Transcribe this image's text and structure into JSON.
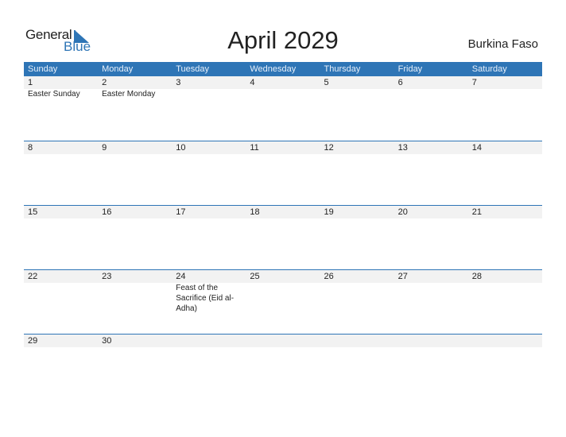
{
  "logo": {
    "general": "General",
    "blue": "Blue",
    "brand_color": "#2e75b6"
  },
  "title": "April 2029",
  "country": "Burkina Faso",
  "weekdays": [
    "Sunday",
    "Monday",
    "Tuesday",
    "Wednesday",
    "Thursday",
    "Friday",
    "Saturday"
  ],
  "weeks": [
    [
      {
        "day": "1",
        "event": "Easter Sunday"
      },
      {
        "day": "2",
        "event": "Easter Monday"
      },
      {
        "day": "3",
        "event": ""
      },
      {
        "day": "4",
        "event": ""
      },
      {
        "day": "5",
        "event": ""
      },
      {
        "day": "6",
        "event": ""
      },
      {
        "day": "7",
        "event": ""
      }
    ],
    [
      {
        "day": "8",
        "event": ""
      },
      {
        "day": "9",
        "event": ""
      },
      {
        "day": "10",
        "event": ""
      },
      {
        "day": "11",
        "event": ""
      },
      {
        "day": "12",
        "event": ""
      },
      {
        "day": "13",
        "event": ""
      },
      {
        "day": "14",
        "event": ""
      }
    ],
    [
      {
        "day": "15",
        "event": ""
      },
      {
        "day": "16",
        "event": ""
      },
      {
        "day": "17",
        "event": ""
      },
      {
        "day": "18",
        "event": ""
      },
      {
        "day": "19",
        "event": ""
      },
      {
        "day": "20",
        "event": ""
      },
      {
        "day": "21",
        "event": ""
      }
    ],
    [
      {
        "day": "22",
        "event": ""
      },
      {
        "day": "23",
        "event": ""
      },
      {
        "day": "24",
        "event": "Feast of the Sacrifice (Eid al-Adha)"
      },
      {
        "day": "25",
        "event": ""
      },
      {
        "day": "26",
        "event": ""
      },
      {
        "day": "27",
        "event": ""
      },
      {
        "day": "28",
        "event": ""
      }
    ],
    [
      {
        "day": "29",
        "event": ""
      },
      {
        "day": "30",
        "event": ""
      },
      {
        "day": "",
        "event": ""
      },
      {
        "day": "",
        "event": ""
      },
      {
        "day": "",
        "event": ""
      },
      {
        "day": "",
        "event": ""
      },
      {
        "day": "",
        "event": ""
      }
    ]
  ]
}
